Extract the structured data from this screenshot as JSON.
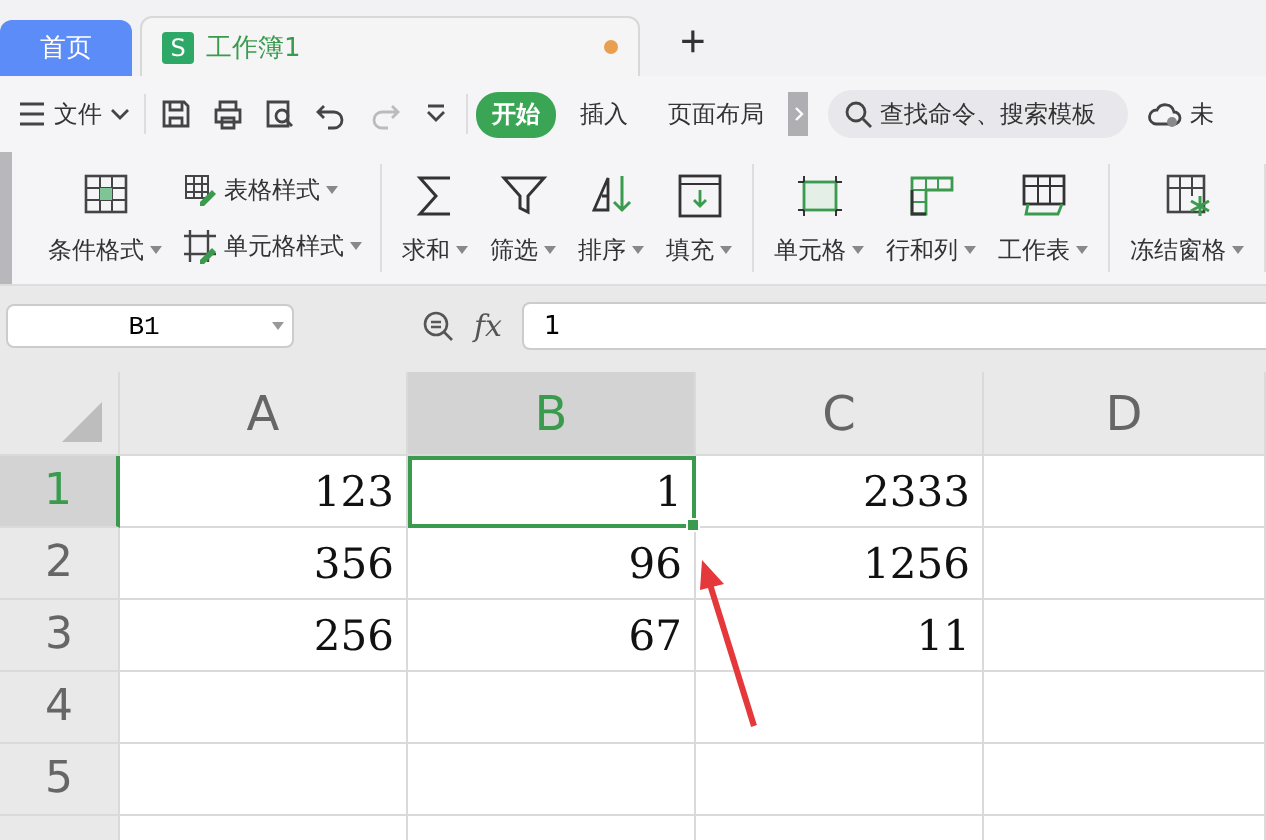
{
  "tabs": [
    {
      "label": "首页",
      "selected": false,
      "unsaved": false
    },
    {
      "label": "工作簿1",
      "badge": "S",
      "selected": true,
      "unsaved": true
    }
  ],
  "new_tab_button": "+",
  "toolbar": {
    "file_menu": "文件",
    "ribbon_tabs": [
      {
        "label": "开始",
        "selected": true
      },
      {
        "label": "插入",
        "selected": false
      },
      {
        "label": "页面布局",
        "selected": false
      }
    ],
    "search": {
      "placeholder": "查找命令、搜索模板"
    },
    "cloud_label": "未"
  },
  "ribbon": {
    "groups": [
      {
        "items": [
          {
            "kind": "large",
            "label": "条件格式"
          },
          {
            "kind": "small",
            "label": "表格样式"
          },
          {
            "kind": "small",
            "label": "单元格样式"
          }
        ]
      },
      {
        "items": [
          {
            "kind": "large",
            "label": "求和"
          },
          {
            "kind": "large",
            "label": "筛选"
          },
          {
            "kind": "large",
            "label": "排序"
          },
          {
            "kind": "large",
            "label": "填充"
          }
        ]
      },
      {
        "items": [
          {
            "kind": "large",
            "label": "单元格"
          },
          {
            "kind": "large",
            "label": "行和列"
          },
          {
            "kind": "large",
            "label": "工作表"
          }
        ]
      },
      {
        "items": [
          {
            "kind": "large",
            "label": "冻结窗格"
          }
        ]
      }
    ]
  },
  "formula_bar": {
    "name_box": "B1",
    "fx": "fx",
    "value": "1"
  },
  "sheet": {
    "columns": [
      {
        "label": "A",
        "selected": false
      },
      {
        "label": "B",
        "selected": true
      },
      {
        "label": "C",
        "selected": false
      },
      {
        "label": "D",
        "selected": false
      }
    ],
    "rows": [
      {
        "header": "1",
        "selected": true,
        "cells": [
          {
            "text": "123",
            "selected": false
          },
          {
            "text": "1",
            "selected": true
          },
          {
            "text": "2333",
            "selected": false
          },
          {
            "selected": false
          }
        ]
      },
      {
        "header": "2",
        "selected": false,
        "cells": [
          {
            "text": "356",
            "selected": false
          },
          {
            "text": "96",
            "selected": false
          },
          {
            "text": "1256",
            "selected": false
          },
          {
            "selected": false
          }
        ]
      },
      {
        "header": "3",
        "selected": false,
        "cells": [
          {
            "text": "256",
            "selected": false
          },
          {
            "text": "67",
            "selected": false
          },
          {
            "text": "11",
            "selected": false
          },
          {
            "selected": false
          }
        ]
      },
      {
        "header": "4",
        "selected": false,
        "cells": [
          {
            "selected": false
          },
          {
            "selected": false
          },
          {
            "selected": false
          },
          {
            "selected": false
          }
        ]
      },
      {
        "header": "5",
        "selected": false,
        "cells": [
          {
            "selected": false
          },
          {
            "selected": false
          },
          {
            "selected": false
          },
          {
            "selected": false
          }
        ]
      }
    ]
  }
}
